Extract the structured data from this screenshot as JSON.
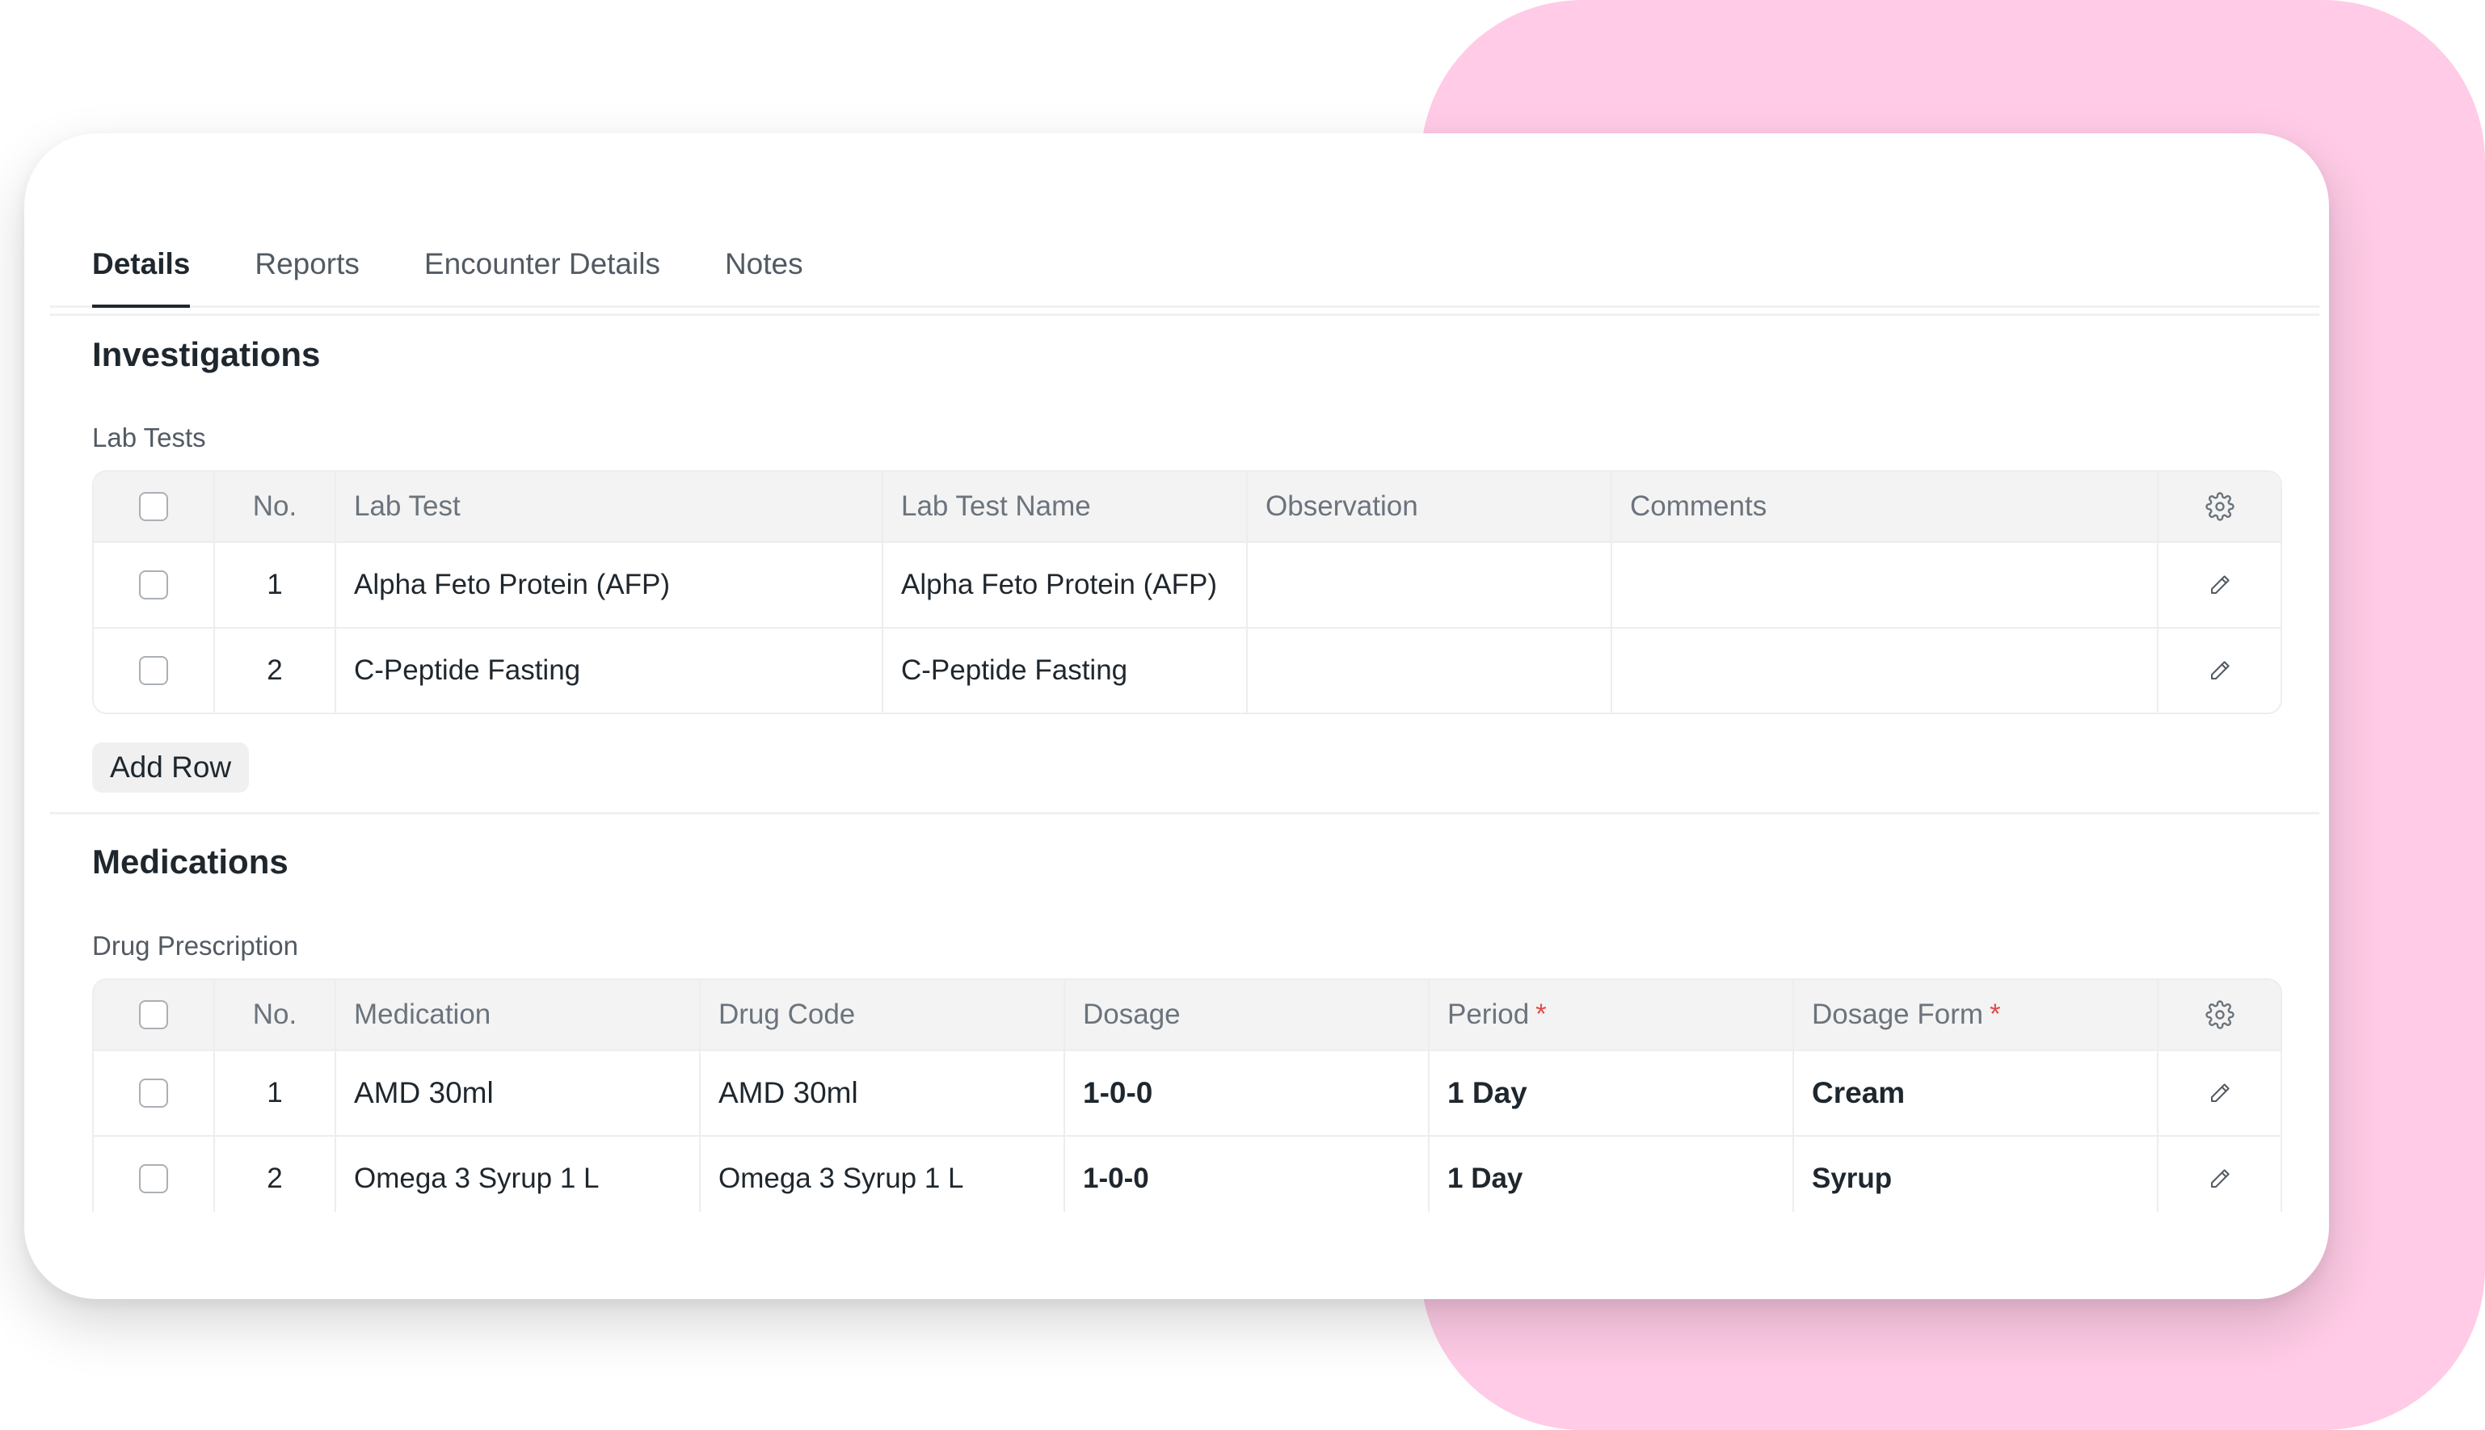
{
  "tabs": [
    {
      "label": "Details"
    },
    {
      "label": "Reports"
    },
    {
      "label": "Encounter Details"
    },
    {
      "label": "Notes"
    }
  ],
  "investigations": {
    "title": "Investigations",
    "lab_tests_label": "Lab Tests",
    "columns": [
      "No.",
      "Lab Test",
      "Lab Test Name",
      "Observation",
      "Comments"
    ],
    "rows": [
      {
        "no": "1",
        "lab_test": "Alpha Feto Protein (AFP)",
        "lab_test_name": "Alpha Feto Protein (AFP)",
        "observation": "",
        "comments": ""
      },
      {
        "no": "2",
        "lab_test": "C-Peptide Fasting",
        "lab_test_name": "C-Peptide Fasting",
        "observation": "",
        "comments": ""
      }
    ],
    "add_row_label": "Add Row"
  },
  "medications": {
    "title": "Medications",
    "drug_prescription_label": "Drug Prescription",
    "columns": [
      "No.",
      "Medication",
      "Drug Code",
      "Dosage",
      "Period",
      "Dosage Form"
    ],
    "required_marker": "*",
    "rows": [
      {
        "no": "1",
        "medication": "AMD 30ml",
        "drug_code": "AMD 30ml",
        "dosage": "1-0-0",
        "period": "1 Day",
        "dosage_form": "Cream"
      },
      {
        "no": "2",
        "medication": "Omega 3 Syrup 1 L",
        "drug_code": "Omega 3 Syrup 1 L",
        "dosage": "1-0-0",
        "period": "1 Day",
        "dosage_form": "Syrup"
      }
    ]
  },
  "colors": {
    "background_accent": "#ffcbe6",
    "required": "#e24c4c"
  }
}
